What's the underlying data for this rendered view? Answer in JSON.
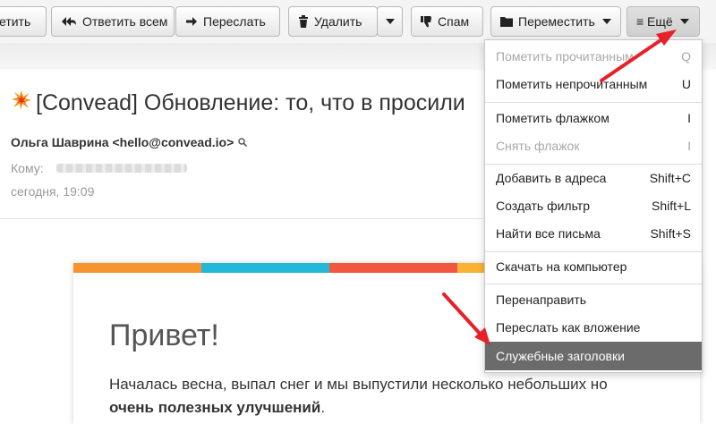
{
  "toolbar": {
    "mark_partial": "етить",
    "reply_all": "Ответить всем",
    "forward": "Переслать",
    "delete": "Удалить",
    "spam": "Спам",
    "move": "Переместить",
    "more": "≡ Ещё"
  },
  "email": {
    "subject": "[Convead] Обновление: то, что в просили",
    "sender": "Ольга Шаврина <hello@convead.io>",
    "to_label": "Кому:",
    "date": "сегодня, 19:09",
    "greeting": "Привет!",
    "body_line1": "Началась весна, выпал снег и мы выпустили несколько небольших но",
    "body_line2_bold": "очень полезных улучшений",
    "body_line2_end": "."
  },
  "menu": {
    "items": [
      {
        "label": "Пометить прочитанным",
        "shortcut": "Q",
        "state": "disabled"
      },
      {
        "label": "Пометить непрочитанным",
        "shortcut": "U",
        "state": "normal"
      },
      {
        "label": "Пометить флажком",
        "shortcut": "I",
        "state": "normal"
      },
      {
        "label": "Снять флажок",
        "shortcut": "I",
        "state": "disabled"
      },
      {
        "label": "Добавить в адреса",
        "shortcut": "Shift+C",
        "state": "normal"
      },
      {
        "label": "Создать фильтр",
        "shortcut": "Shift+L",
        "state": "normal"
      },
      {
        "label": "Найти все письма",
        "shortcut": "Shift+S",
        "state": "normal"
      },
      {
        "label": "Скачать на компьютер",
        "shortcut": "",
        "state": "normal"
      },
      {
        "label": "Перенаправить",
        "shortcut": "",
        "state": "normal"
      },
      {
        "label": "Переслать как вложение",
        "shortcut": "",
        "state": "normal"
      },
      {
        "label": "Служебные заголовки",
        "shortcut": "",
        "state": "selected"
      }
    ]
  },
  "colors": {
    "stripe_orange": "#f7942d",
    "stripe_blue": "#22b8d8",
    "stripe_red": "#f25540",
    "stripe_yellow": "#f9b232",
    "arrow_red": "#e8202a",
    "menu_selected": "#6b6b6b"
  }
}
